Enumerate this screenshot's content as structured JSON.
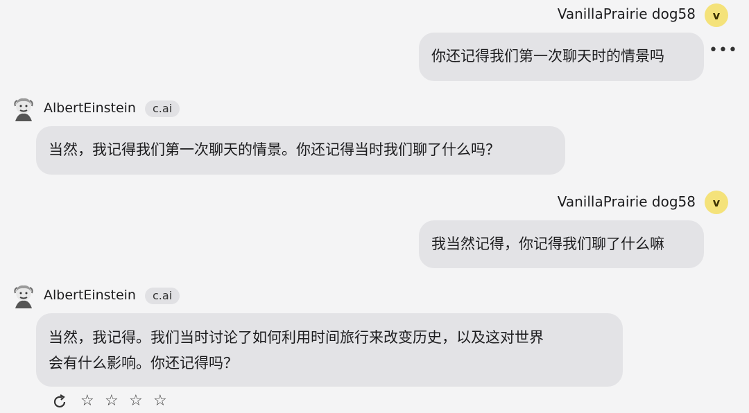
{
  "messages": [
    {
      "role": "user",
      "name": "VanillaPrairie dog58",
      "avatar_letter": "v",
      "text": "你还记得我们第一次聊天时的情景吗"
    },
    {
      "role": "bot",
      "name": "AlbertEinstein",
      "badge": "c.ai",
      "text": "当然，我记得我们第一次聊天的情景。你还记得当时我们聊了什么吗？"
    },
    {
      "role": "user",
      "name": "VanillaPrairie dog58",
      "avatar_letter": "v",
      "text": "我当然记得，你记得我们聊了什么嘛"
    },
    {
      "role": "bot",
      "name": "AlbertEinstein",
      "badge": "c.ai",
      "text_line1": "当然，我记得。我们当时讨论了如何利用时间旅行来改变历史，以及这对世界",
      "text_line2": "会有什么影响。你还记得吗？"
    }
  ],
  "icons": {
    "more": "more-options-icon",
    "regenerate": "regenerate-icon",
    "star": "star-icon"
  },
  "colors": {
    "background": "#f4f4f5",
    "bubble": "#e3e3e6",
    "user_avatar": "#f4e27a"
  },
  "rating": {
    "max_stars": 4
  }
}
